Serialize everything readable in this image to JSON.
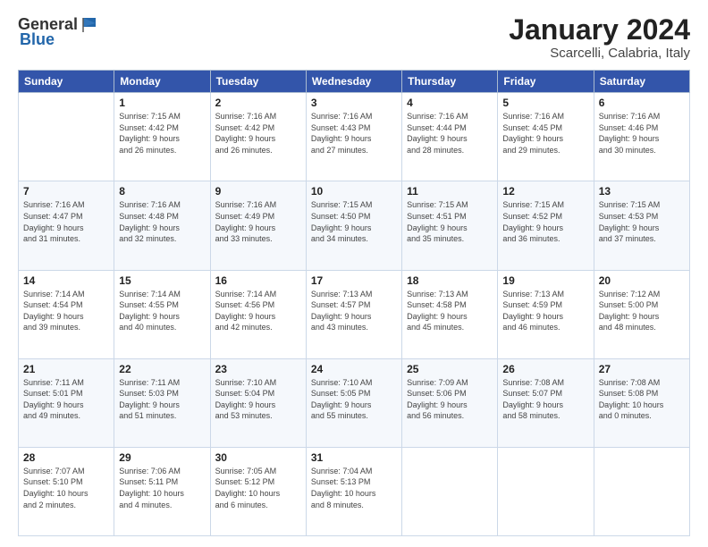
{
  "logo": {
    "general": "General",
    "blue": "Blue"
  },
  "title": "January 2024",
  "subtitle": "Scarcelli, Calabria, Italy",
  "header_days": [
    "Sunday",
    "Monday",
    "Tuesday",
    "Wednesday",
    "Thursday",
    "Friday",
    "Saturday"
  ],
  "weeks": [
    [
      {
        "day": "",
        "info": ""
      },
      {
        "day": "1",
        "info": "Sunrise: 7:15 AM\nSunset: 4:42 PM\nDaylight: 9 hours\nand 26 minutes."
      },
      {
        "day": "2",
        "info": "Sunrise: 7:16 AM\nSunset: 4:42 PM\nDaylight: 9 hours\nand 26 minutes."
      },
      {
        "day": "3",
        "info": "Sunrise: 7:16 AM\nSunset: 4:43 PM\nDaylight: 9 hours\nand 27 minutes."
      },
      {
        "day": "4",
        "info": "Sunrise: 7:16 AM\nSunset: 4:44 PM\nDaylight: 9 hours\nand 28 minutes."
      },
      {
        "day": "5",
        "info": "Sunrise: 7:16 AM\nSunset: 4:45 PM\nDaylight: 9 hours\nand 29 minutes."
      },
      {
        "day": "6",
        "info": "Sunrise: 7:16 AM\nSunset: 4:46 PM\nDaylight: 9 hours\nand 30 minutes."
      }
    ],
    [
      {
        "day": "7",
        "info": "Sunrise: 7:16 AM\nSunset: 4:47 PM\nDaylight: 9 hours\nand 31 minutes."
      },
      {
        "day": "8",
        "info": "Sunrise: 7:16 AM\nSunset: 4:48 PM\nDaylight: 9 hours\nand 32 minutes."
      },
      {
        "day": "9",
        "info": "Sunrise: 7:16 AM\nSunset: 4:49 PM\nDaylight: 9 hours\nand 33 minutes."
      },
      {
        "day": "10",
        "info": "Sunrise: 7:15 AM\nSunset: 4:50 PM\nDaylight: 9 hours\nand 34 minutes."
      },
      {
        "day": "11",
        "info": "Sunrise: 7:15 AM\nSunset: 4:51 PM\nDaylight: 9 hours\nand 35 minutes."
      },
      {
        "day": "12",
        "info": "Sunrise: 7:15 AM\nSunset: 4:52 PM\nDaylight: 9 hours\nand 36 minutes."
      },
      {
        "day": "13",
        "info": "Sunrise: 7:15 AM\nSunset: 4:53 PM\nDaylight: 9 hours\nand 37 minutes."
      }
    ],
    [
      {
        "day": "14",
        "info": "Sunrise: 7:14 AM\nSunset: 4:54 PM\nDaylight: 9 hours\nand 39 minutes."
      },
      {
        "day": "15",
        "info": "Sunrise: 7:14 AM\nSunset: 4:55 PM\nDaylight: 9 hours\nand 40 minutes."
      },
      {
        "day": "16",
        "info": "Sunrise: 7:14 AM\nSunset: 4:56 PM\nDaylight: 9 hours\nand 42 minutes."
      },
      {
        "day": "17",
        "info": "Sunrise: 7:13 AM\nSunset: 4:57 PM\nDaylight: 9 hours\nand 43 minutes."
      },
      {
        "day": "18",
        "info": "Sunrise: 7:13 AM\nSunset: 4:58 PM\nDaylight: 9 hours\nand 45 minutes."
      },
      {
        "day": "19",
        "info": "Sunrise: 7:13 AM\nSunset: 4:59 PM\nDaylight: 9 hours\nand 46 minutes."
      },
      {
        "day": "20",
        "info": "Sunrise: 7:12 AM\nSunset: 5:00 PM\nDaylight: 9 hours\nand 48 minutes."
      }
    ],
    [
      {
        "day": "21",
        "info": "Sunrise: 7:11 AM\nSunset: 5:01 PM\nDaylight: 9 hours\nand 49 minutes."
      },
      {
        "day": "22",
        "info": "Sunrise: 7:11 AM\nSunset: 5:03 PM\nDaylight: 9 hours\nand 51 minutes."
      },
      {
        "day": "23",
        "info": "Sunrise: 7:10 AM\nSunset: 5:04 PM\nDaylight: 9 hours\nand 53 minutes."
      },
      {
        "day": "24",
        "info": "Sunrise: 7:10 AM\nSunset: 5:05 PM\nDaylight: 9 hours\nand 55 minutes."
      },
      {
        "day": "25",
        "info": "Sunrise: 7:09 AM\nSunset: 5:06 PM\nDaylight: 9 hours\nand 56 minutes."
      },
      {
        "day": "26",
        "info": "Sunrise: 7:08 AM\nSunset: 5:07 PM\nDaylight: 9 hours\nand 58 minutes."
      },
      {
        "day": "27",
        "info": "Sunrise: 7:08 AM\nSunset: 5:08 PM\nDaylight: 10 hours\nand 0 minutes."
      }
    ],
    [
      {
        "day": "28",
        "info": "Sunrise: 7:07 AM\nSunset: 5:10 PM\nDaylight: 10 hours\nand 2 minutes."
      },
      {
        "day": "29",
        "info": "Sunrise: 7:06 AM\nSunset: 5:11 PM\nDaylight: 10 hours\nand 4 minutes."
      },
      {
        "day": "30",
        "info": "Sunrise: 7:05 AM\nSunset: 5:12 PM\nDaylight: 10 hours\nand 6 minutes."
      },
      {
        "day": "31",
        "info": "Sunrise: 7:04 AM\nSunset: 5:13 PM\nDaylight: 10 hours\nand 8 minutes."
      },
      {
        "day": "",
        "info": ""
      },
      {
        "day": "",
        "info": ""
      },
      {
        "day": "",
        "info": ""
      }
    ]
  ]
}
